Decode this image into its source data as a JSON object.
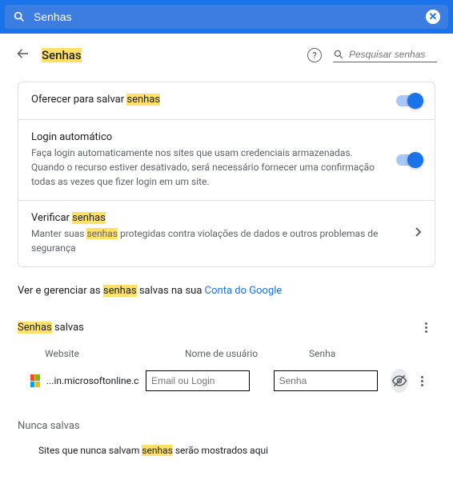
{
  "topbar": {
    "search_value": "Senhas"
  },
  "header": {
    "title_hl": "Senhas",
    "local_search_placeholder": "Pesquisar senhas"
  },
  "offer": {
    "label_pre": "Oferecer para salvar ",
    "label_hl": "senhas"
  },
  "autologin": {
    "title": "Login automático",
    "desc": "Faça login automaticamente nos sites que usam credenciais armazenadas. Quando o recurso estiver desativado, será necessário fornecer uma confirmação todas as vezes que fizer login em um site."
  },
  "verify": {
    "title_pre": "Verificar ",
    "title_hl": "senhas",
    "desc_pre": "Manter suas ",
    "desc_hl": "senhas",
    "desc_post": " protegidas contra violações de dados e outros problemas de segurança"
  },
  "manage": {
    "pre": "Ver e gerenciar as ",
    "hl": "senhas",
    "post": " salvas na sua  ",
    "link": "Conta do Google"
  },
  "saved": {
    "title_hl": "Senhas",
    "title_post": " salvas",
    "col_website": "Website",
    "col_user": "Nome de usuário",
    "col_pass": "Senha",
    "row": {
      "site": "...in.microsoftonline.com",
      "user_placeholder": "Email ou Login",
      "pass_placeholder": "Senha"
    }
  },
  "never": {
    "title": "Nunca salvas",
    "desc_pre": "Sites que nunca salvam ",
    "desc_hl": "senhas",
    "desc_post": " serão mostrados aqui"
  }
}
